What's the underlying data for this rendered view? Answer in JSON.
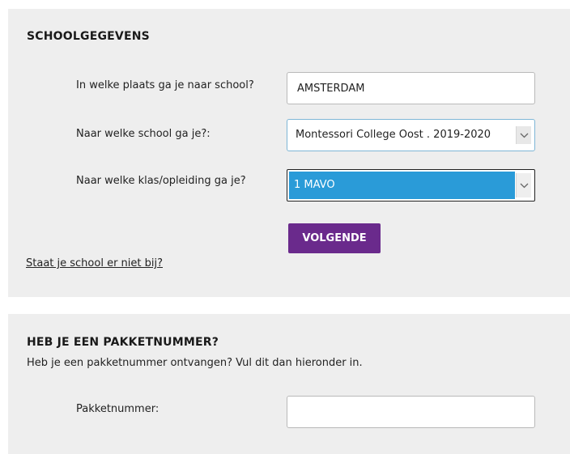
{
  "school_section": {
    "title": "SCHOOLGEGEVENS",
    "city_label": "In welke plaats ga je naar school?",
    "city_value": "AMSTERDAM",
    "school_label": "Naar welke school ga je?:",
    "school_value": "Montessori College Oost . 2019-2020",
    "class_label": "Naar welke klas/opleiding ga je?",
    "class_value": "1 MAVO",
    "next_button": "VOLGENDE",
    "missing_school_link": "Staat je school er niet bij?"
  },
  "package_section": {
    "title": "HEB JE EEN PAKKETNUMMER?",
    "description": "Heb je een pakketnummer ontvangen? Vul dit dan hieronder in.",
    "package_label": "Pakketnummer:",
    "package_value": ""
  },
  "colors": {
    "panel_bg": "#eeeeee",
    "button_purple": "#6a2a8c",
    "select_highlight": "#2a9bd8"
  },
  "icons": {
    "dropdown": "chevron-down-icon"
  }
}
